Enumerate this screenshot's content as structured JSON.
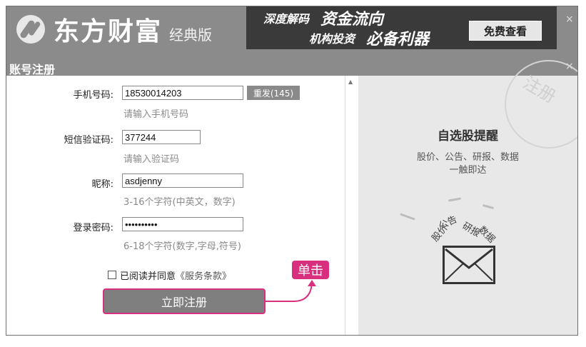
{
  "header": {
    "brand": "东方财富",
    "edition": "经典版",
    "ad": {
      "line1_small": "深度解码",
      "line1_large": "资金流向",
      "line2_small": "机构投资",
      "line2_large": "必备利器",
      "button": "免费查看"
    },
    "ad_close": "×"
  },
  "window": {
    "title": "账号注册",
    "close": "×"
  },
  "form": {
    "phone": {
      "label": "手机号码:",
      "value": "18530014203",
      "hint": "请输入手机号码",
      "resend": "重发(145)"
    },
    "sms": {
      "label": "短信验证码:",
      "value": "377244",
      "hint": "请输入验证码"
    },
    "nickname": {
      "label": "昵称:",
      "value": "asdjenny",
      "hint": "3-16个字符(中英文，数字)"
    },
    "password": {
      "label": "登录密码:",
      "value": "••••••••••",
      "hint": "6-18个字符(数字,字母,符号)"
    },
    "agree": {
      "text": "已阅读并同意",
      "terms": "《服务条款》",
      "checked": false
    },
    "register": "立即注册",
    "callout": "单击"
  },
  "promo": {
    "stamp": "注册",
    "title": "自选股提醒",
    "line1": "股价、公告、研报、数据",
    "line2": "一触即达",
    "words": [
      "股价",
      "公告",
      "研报",
      "数据"
    ]
  },
  "colors": {
    "callout": "#d8307e",
    "header": "#8b8b8b",
    "ad_bg": "#3a3a3a"
  }
}
